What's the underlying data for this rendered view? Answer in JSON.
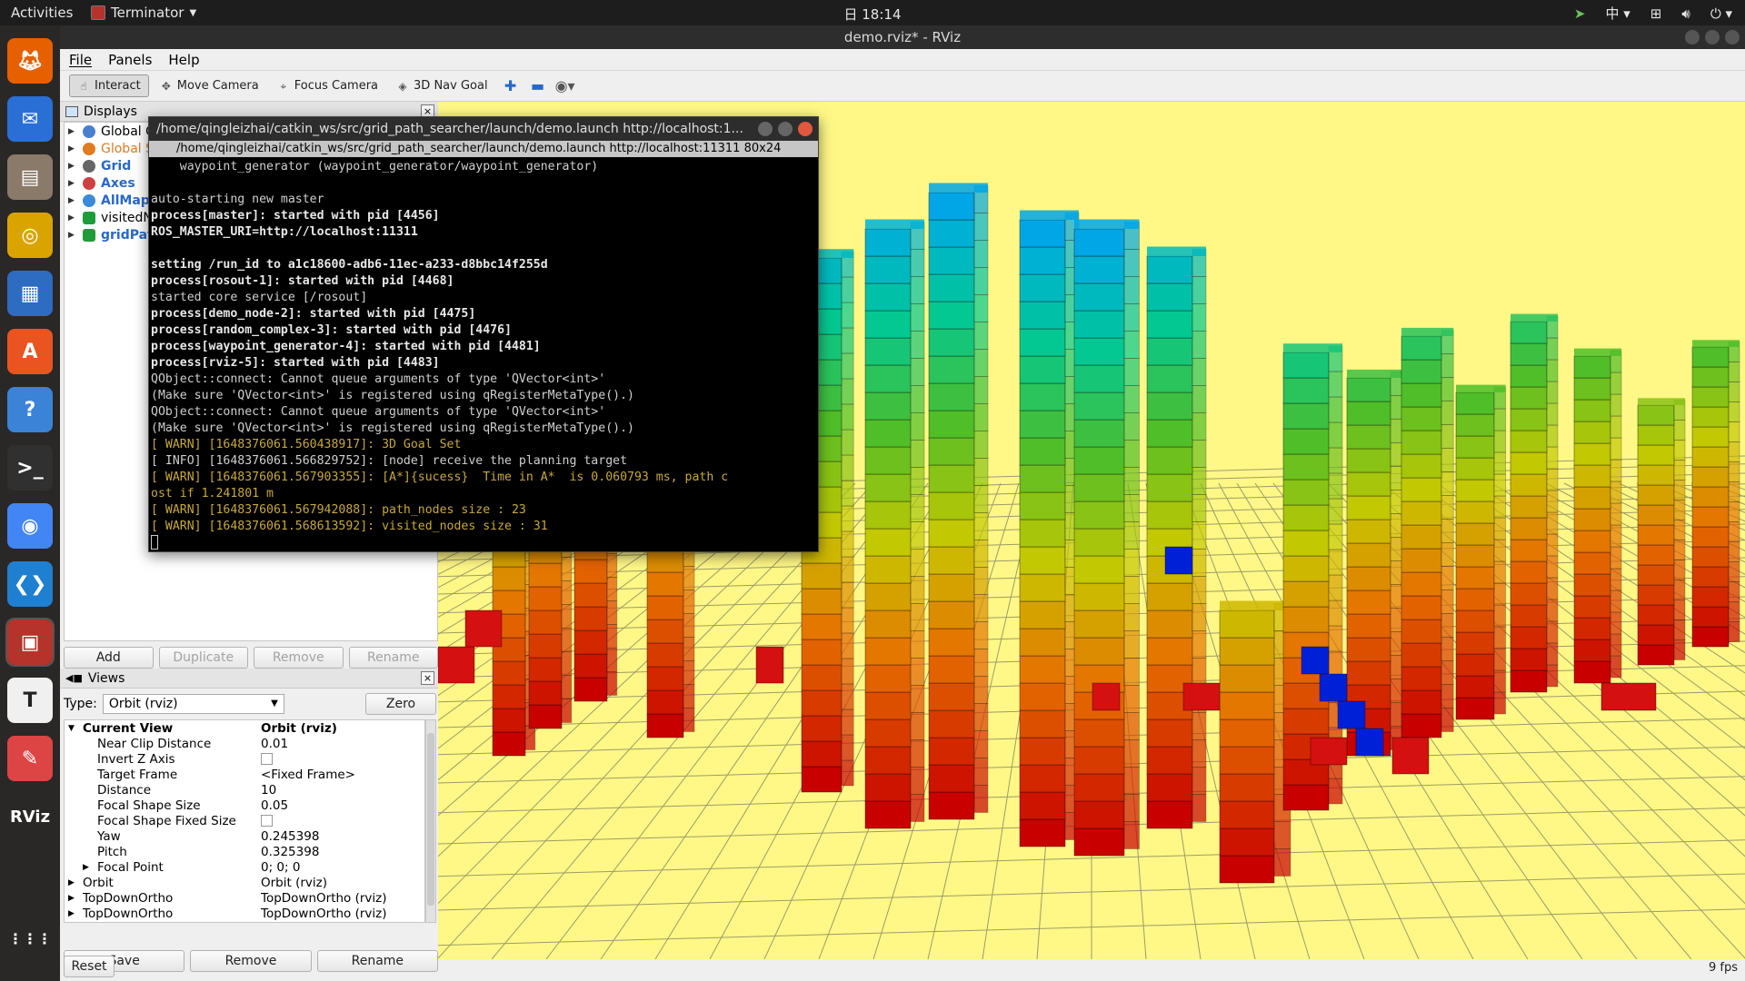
{
  "topbar": {
    "activities": "Activities",
    "app_name": "Terminator",
    "clock": "日 18:14",
    "input_method": "中"
  },
  "rviz": {
    "title": "demo.rviz* - RViz",
    "menu": [
      "File",
      "Panels",
      "Help"
    ],
    "tools": [
      {
        "label": "Interact",
        "icon": "interact-icon",
        "active": true
      },
      {
        "label": "Move Camera",
        "icon": "move-camera-icon",
        "active": false
      },
      {
        "label": "Focus Camera",
        "icon": "focus-camera-icon",
        "active": false
      },
      {
        "label": "3D Nav Goal",
        "icon": "nav-goal-icon",
        "active": false
      }
    ],
    "displays": {
      "title": "Displays",
      "items": [
        {
          "label": "Global O",
          "icon": "gear-icon",
          "style": "normal"
        },
        {
          "label": "Global S",
          "icon": "warning-icon",
          "style": "orange"
        },
        {
          "label": "Grid",
          "icon": "grid-icon",
          "style": "blue"
        },
        {
          "label": "Axes",
          "icon": "axes-icon",
          "style": "blue"
        },
        {
          "label": "AllMap",
          "icon": "pointcloud-icon",
          "style": "blue"
        },
        {
          "label": "visitedN",
          "icon": "marker-icon",
          "style": "normal"
        },
        {
          "label": "gridPat",
          "icon": "marker-icon",
          "style": "blue"
        }
      ],
      "buttons": {
        "add": "Add",
        "duplicate": "Duplicate",
        "remove": "Remove",
        "rename": "Rename"
      }
    },
    "views": {
      "title": "Views",
      "type_label": "Type:",
      "type_value": "Orbit (rviz)",
      "zero_label": "Zero",
      "rows": [
        {
          "key": "Current View",
          "value": "Orbit (rviz)",
          "indent": 0,
          "expand": "open",
          "head": true
        },
        {
          "key": "Near Clip Distance",
          "value": "0.01",
          "indent": 1
        },
        {
          "key": "Invert Z Axis",
          "value": "",
          "indent": 1,
          "checkbox": true
        },
        {
          "key": "Target Frame",
          "value": "<Fixed Frame>",
          "indent": 1
        },
        {
          "key": "Distance",
          "value": "10",
          "indent": 1
        },
        {
          "key": "Focal Shape Size",
          "value": "0.05",
          "indent": 1
        },
        {
          "key": "Focal Shape Fixed Size",
          "value": "",
          "indent": 1,
          "checkbox": true
        },
        {
          "key": "Yaw",
          "value": "0.245398",
          "indent": 1
        },
        {
          "key": "Pitch",
          "value": "0.325398",
          "indent": 1
        },
        {
          "key": "Focal Point",
          "value": "0; 0; 0",
          "indent": 1,
          "expand": "closed"
        },
        {
          "key": "Orbit",
          "value": "Orbit (rviz)",
          "indent": 0,
          "expand": "closed"
        },
        {
          "key": "TopDownOrtho",
          "value": "TopDownOrtho (rviz)",
          "indent": 0,
          "expand": "closed"
        },
        {
          "key": "TopDownOrtho",
          "value": "TopDownOrtho (rviz)",
          "indent": 0,
          "expand": "closed"
        }
      ],
      "buttons": {
        "save": "Save",
        "remove": "Remove",
        "rename": "Rename"
      }
    },
    "reset_label": "Reset",
    "fps": "9 fps"
  },
  "terminal": {
    "title": "/home/qingleizhai/catkin_ws/src/grid_path_searcher/launch/demo.launch http://localhost:1...",
    "tab": "/home/qingleizhai/catkin_ws/src/grid_path_searcher/launch/demo.launch http://localhost:11311 80x24",
    "lines": [
      {
        "text": "    waypoint_generator (waypoint_generator/waypoint_generator)",
        "style": "normal"
      },
      {
        "text": "",
        "style": "normal"
      },
      {
        "text": "auto-starting new master",
        "style": "normal"
      },
      {
        "text": "process[master]: started with pid [4456]",
        "style": "bold"
      },
      {
        "text": "ROS_MASTER_URI=http://localhost:11311",
        "style": "bold"
      },
      {
        "text": "",
        "style": "normal"
      },
      {
        "text": "setting /run_id to a1c18600-adb6-11ec-a233-d8bbc14f255d",
        "style": "bold"
      },
      {
        "text": "process[rosout-1]: started with pid [4468]",
        "style": "bold"
      },
      {
        "text": "started core service [/rosout]",
        "style": "normal"
      },
      {
        "text": "process[demo_node-2]: started with pid [4475]",
        "style": "bold"
      },
      {
        "text": "process[random_complex-3]: started with pid [4476]",
        "style": "bold"
      },
      {
        "text": "process[waypoint_generator-4]: started with pid [4481]",
        "style": "bold"
      },
      {
        "text": "process[rviz-5]: started with pid [4483]",
        "style": "bold"
      },
      {
        "text": "QObject::connect: Cannot queue arguments of type 'QVector<int>'",
        "style": "normal"
      },
      {
        "text": "(Make sure 'QVector<int>' is registered using qRegisterMetaType().)",
        "style": "normal"
      },
      {
        "text": "QObject::connect: Cannot queue arguments of type 'QVector<int>'",
        "style": "normal"
      },
      {
        "text": "(Make sure 'QVector<int>' is registered using qRegisterMetaType().)",
        "style": "normal"
      },
      {
        "text": "[ WARN] [1648376061.560438917]: 3D Goal Set",
        "style": "warn"
      },
      {
        "text": "[ INFO] [1648376061.566829752]: [node] receive the planning target",
        "style": "info"
      },
      {
        "text": "[ WARN] [1648376061.567903355]: [A*]{sucess}  Time in A*  is 0.060793 ms, path c",
        "style": "warn"
      },
      {
        "text": "ost if 1.241801 m",
        "style": "warn"
      },
      {
        "text": "[ WARN] [1648376061.567942088]: path_nodes size : 23",
        "style": "warn"
      },
      {
        "text": "[ WARN] [1648376061.568613592]: visited_nodes size : 31",
        "style": "warn"
      }
    ]
  },
  "dock": [
    {
      "name": "firefox-icon",
      "color": "#e66000"
    },
    {
      "name": "thunderbird-icon",
      "color": "#2a6fd6"
    },
    {
      "name": "files-icon",
      "color": "#8a7a6a"
    },
    {
      "name": "rhythmbox-icon",
      "color": "#d9a400"
    },
    {
      "name": "libreoffice-writer-icon",
      "color": "#2d6cc0"
    },
    {
      "name": "software-center-icon",
      "color": "#e95420"
    },
    {
      "name": "help-icon",
      "color": "#3b83d6"
    },
    {
      "name": "terminal-icon",
      "color": "#303030"
    },
    {
      "name": "chrome-icon",
      "color": "#4285f4"
    },
    {
      "name": "vscode-icon",
      "color": "#1f7fd0"
    },
    {
      "name": "terminator-icon",
      "color": "#b5332a"
    },
    {
      "name": "typora-icon",
      "color": "#f0f0f0"
    },
    {
      "name": "xournal-icon",
      "color": "#d44"
    },
    {
      "name": "rviz-icon",
      "color": "#2a2727"
    },
    {
      "name": "show-apps-icon",
      "color": "#2a2727"
    }
  ]
}
